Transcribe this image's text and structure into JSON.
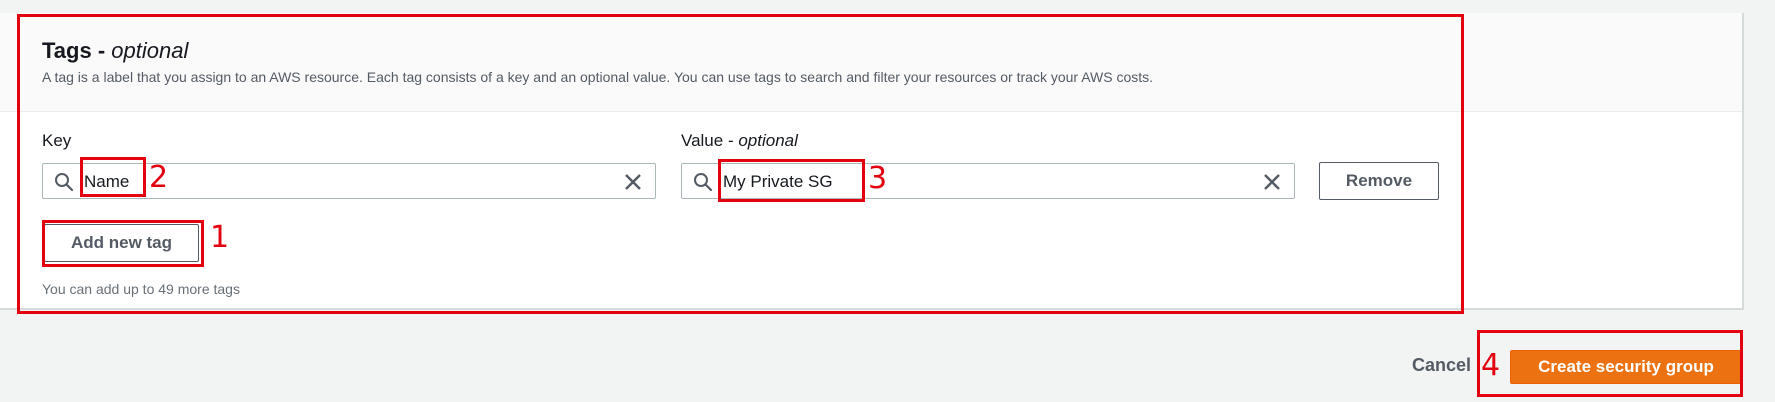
{
  "tags_section": {
    "title": "Tags - ",
    "title_optional": "optional",
    "description": "A tag is a label that you assign to an AWS resource. Each tag consists of a key and an optional value. You can use tags to search and filter your resources or track your AWS costs.",
    "key_label": "Key",
    "value_label": "Value - ",
    "value_label_optional": "optional",
    "key_value": "Name",
    "value_value": "My Private SG",
    "remove_label": "Remove",
    "add_tag_label": "Add new tag",
    "hint": "You can add up to 49 more tags"
  },
  "footer": {
    "cancel_label": "Cancel",
    "create_label": "Create security group"
  },
  "annotations": {
    "n1": "1",
    "n2": "2",
    "n3": "3",
    "n4": "4"
  },
  "colors": {
    "primary": "#ec7211",
    "annotation": "#e3000f",
    "text": "#16191f",
    "secondary_text": "#545b64"
  },
  "icons": {
    "search": "search-icon",
    "clear": "close-icon"
  }
}
